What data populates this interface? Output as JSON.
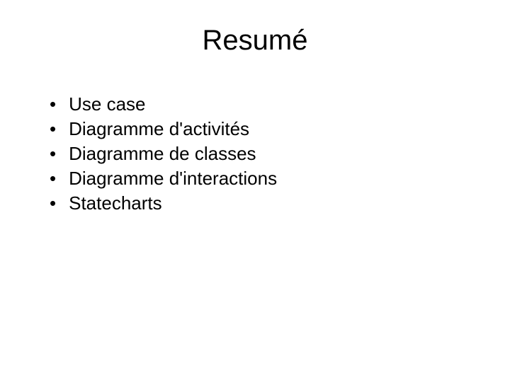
{
  "slide": {
    "title": "Resumé",
    "bullets": [
      "Use case",
      "Diagramme d'activités",
      "Diagramme de classes",
      "Diagramme d'interactions",
      "Statecharts"
    ]
  }
}
